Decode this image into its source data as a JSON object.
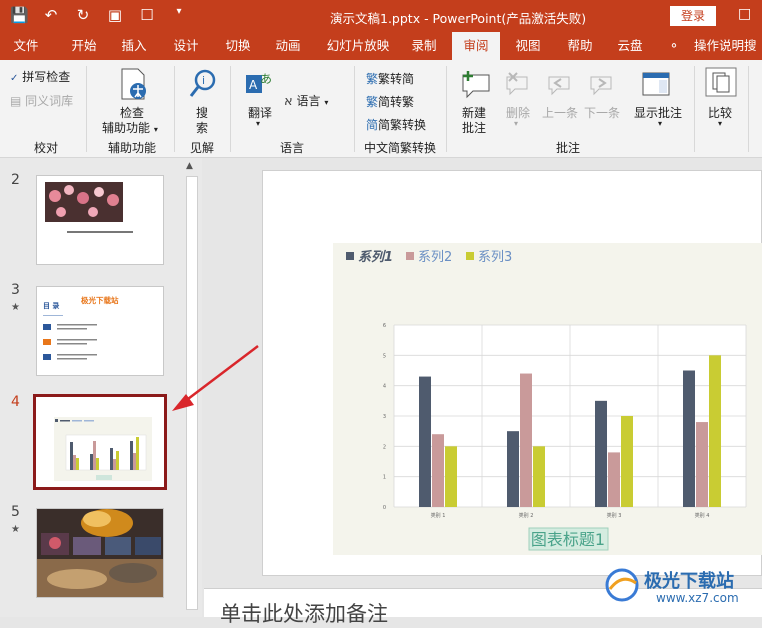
{
  "window": {
    "title": "演示文稿1.pptx - PowerPoint(产品激活失败)",
    "login_label": "登录"
  },
  "tabs": [
    "文件",
    "开始",
    "插入",
    "设计",
    "切换",
    "动画",
    "幻灯片放映",
    "录制",
    "审阅",
    "视图",
    "帮助",
    "云盘"
  ],
  "active_tab": "审阅",
  "tell_me": "操作说明搜",
  "ribbon": {
    "proofing": {
      "spell": "拼写检查",
      "thesaurus": "同义词库",
      "label": "校对"
    },
    "accessibility": {
      "button_line1": "检查",
      "button_line2": "辅助功能",
      "label": "辅助功能"
    },
    "insights": {
      "button_line1": "搜",
      "button_line2": "索",
      "label": "见解"
    },
    "language": {
      "translate": "翻译",
      "language": "语言",
      "label": "语言"
    },
    "chinese": {
      "to_simplified": "繁转简",
      "to_traditional": "简转繁",
      "convert": "简繁转换",
      "label": "中文简繁转换"
    },
    "comments": {
      "new_line1": "新建",
      "new_line2": "批注",
      "delete": "删除",
      "previous": "上一条",
      "next": "下一条",
      "show_line1": "显示批注",
      "label": "批注"
    },
    "compare": {
      "button": "比较"
    }
  },
  "thumbnails": [
    {
      "number": "2",
      "starred": false
    },
    {
      "number": "3",
      "starred": true,
      "title": "极光下载站",
      "toc": "目 录"
    },
    {
      "number": "4",
      "starred": false,
      "selected": true
    },
    {
      "number": "5",
      "starred": true
    }
  ],
  "chart_data": {
    "type": "bar",
    "categories": [
      "类别 1",
      "类别 2",
      "类别 3",
      "类别 4"
    ],
    "series": [
      {
        "name": "系列1",
        "values": [
          4.3,
          2.5,
          3.5,
          4.5
        ],
        "color": "#4f5b6e"
      },
      {
        "name": "系列2",
        "values": [
          2.4,
          4.4,
          1.8,
          2.8
        ],
        "color": "#c99a9a"
      },
      {
        "name": "系列3",
        "values": [
          2.0,
          2.0,
          3.0,
          5.0
        ],
        "color": "#c9cc33"
      }
    ],
    "title": "图表标题1",
    "ylim": [
      0,
      6
    ],
    "yticks": [
      "0",
      "1",
      "2",
      "3",
      "4",
      "5",
      "6"
    ],
    "grid": true,
    "legend": "top-left"
  },
  "notes_placeholder": "单击此处添加备注",
  "watermark": {
    "name": "极光下载站",
    "url": "www.xz7.com"
  },
  "colors": {
    "accent": "#c43e1c",
    "selection": "#8b1a1a",
    "arrow": "#d9262b"
  }
}
